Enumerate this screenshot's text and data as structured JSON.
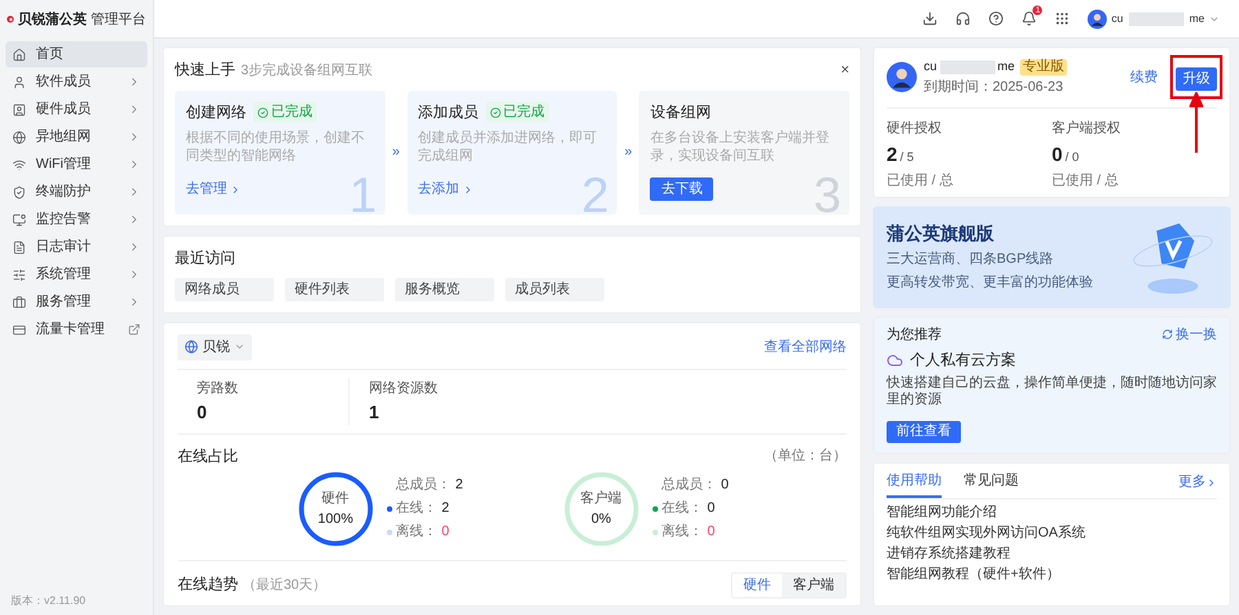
{
  "brand": {
    "name": "贝锐蒲公英",
    "subtitle": "管理平台"
  },
  "sidebar": {
    "items": [
      {
        "label": "首页",
        "selected": true,
        "kind": "plain"
      },
      {
        "label": "软件成员",
        "selected": false,
        "kind": "submenu"
      },
      {
        "label": "硬件成员",
        "selected": false,
        "kind": "submenu"
      },
      {
        "label": "异地组网",
        "selected": false,
        "kind": "submenu"
      },
      {
        "label": "WiFi管理",
        "selected": false,
        "kind": "submenu"
      },
      {
        "label": "终端防护",
        "selected": false,
        "kind": "submenu"
      },
      {
        "label": "监控告警",
        "selected": false,
        "kind": "submenu"
      },
      {
        "label": "日志审计",
        "selected": false,
        "kind": "submenu"
      },
      {
        "label": "系统管理",
        "selected": false,
        "kind": "submenu"
      },
      {
        "label": "服务管理",
        "selected": false,
        "kind": "submenu"
      },
      {
        "label": "流量卡管理",
        "selected": false,
        "kind": "external"
      }
    ],
    "version": "版本：v2.11.90"
  },
  "header": {
    "notification_count": "1",
    "user": {
      "name_start": "cu",
      "name_end": "me"
    }
  },
  "quick_start": {
    "title": "快速上手",
    "subtitle": "3步完成设备组网互联",
    "close": "×",
    "separator": "»",
    "steps": [
      {
        "title": "创建网络",
        "completed": true,
        "badge": "已完成",
        "description": "根据不同的使用场景，创建不同类型的智能网络",
        "action": "去管理",
        "kind": "link",
        "number": "1"
      },
      {
        "title": "添加成员",
        "completed": true,
        "badge": "已完成",
        "description": "创建成员并添加进网络，即可完成组网",
        "action": "去添加",
        "kind": "link",
        "number": "2"
      },
      {
        "title": "设备组网",
        "completed": false,
        "description": "在多台设备上安装客户端并登录，实现设备间互联",
        "action": "去下载",
        "kind": "button",
        "number": "3"
      }
    ]
  },
  "recent": {
    "title": "最近访问",
    "items": [
      "网络成员",
      "硬件列表",
      "服务概览",
      "成员列表"
    ]
  },
  "network": {
    "selector": "贝锐",
    "view_all": "查看全部网络",
    "stats": [
      {
        "label": "旁路数",
        "value": "0"
      },
      {
        "label": "网络资源数",
        "value": "1"
      }
    ],
    "online_ratio": {
      "title": "在线占比",
      "unit": "（单位：台）",
      "donuts": [
        {
          "label": "硬件",
          "percent": "100%",
          "level": 1,
          "legend": [
            {
              "label": "总成员：",
              "value": "2",
              "kind": "plain",
              "alert": false
            },
            {
              "label": "在线：",
              "value": "2",
              "kind": "dot",
              "color": "#1a5cff",
              "alert": false
            },
            {
              "label": "离线：",
              "value": "0",
              "kind": "dot",
              "color": "#c9d9ff",
              "alert": true
            }
          ]
        },
        {
          "label": "客户端",
          "percent": "0%",
          "level": 0,
          "legend": [
            {
              "label": "总成员：",
              "value": "0",
              "kind": "plain",
              "alert": false
            },
            {
              "label": "在线：",
              "value": "0",
              "kind": "dot",
              "color": "#00a854",
              "alert": false
            },
            {
              "label": "离线：",
              "value": "0",
              "kind": "dot",
              "color": "#c8efd6",
              "alert": true
            }
          ]
        }
      ]
    },
    "trend": {
      "title": "在线趋势",
      "note": "（最近30天）",
      "tabs": [
        {
          "label": "硬件",
          "selected": true
        },
        {
          "label": "客户端",
          "selected": false
        }
      ]
    }
  },
  "account": {
    "name_start": "cu",
    "name_end": "me",
    "badge": "专业版",
    "expiry": "到期时间：2025-06-23",
    "renew": "续费",
    "upgrade": "升级",
    "licenses": [
      {
        "label": "硬件授权",
        "used": "2",
        "total": "/ 5",
        "caption": "已使用 / 总"
      },
      {
        "label": "客户端授权",
        "used": "0",
        "total": "/ 0",
        "caption": "已使用 / 总"
      }
    ]
  },
  "banner": {
    "title": "蒲公英旗舰版",
    "lines": [
      "三大运营商、四条BGP线路",
      "更高转发带宽、更丰富的功能体验"
    ]
  },
  "recommend": {
    "title": "为您推荐",
    "refresh": "换一换",
    "product": "个人私有云方案",
    "description": "快速搭建自己的云盘，操作简单便捷，随时随地访问家里的资源",
    "action": "前往查看"
  },
  "help": {
    "tabs": [
      {
        "label": "使用帮助",
        "selected": true
      },
      {
        "label": "常见问题",
        "selected": false
      }
    ],
    "more": "更多",
    "items": [
      "智能组网功能介绍",
      "纯软件组网实现外网访问OA系统",
      "进销存系统搭建教程",
      "智能组网教程（硬件+软件）"
    ]
  }
}
